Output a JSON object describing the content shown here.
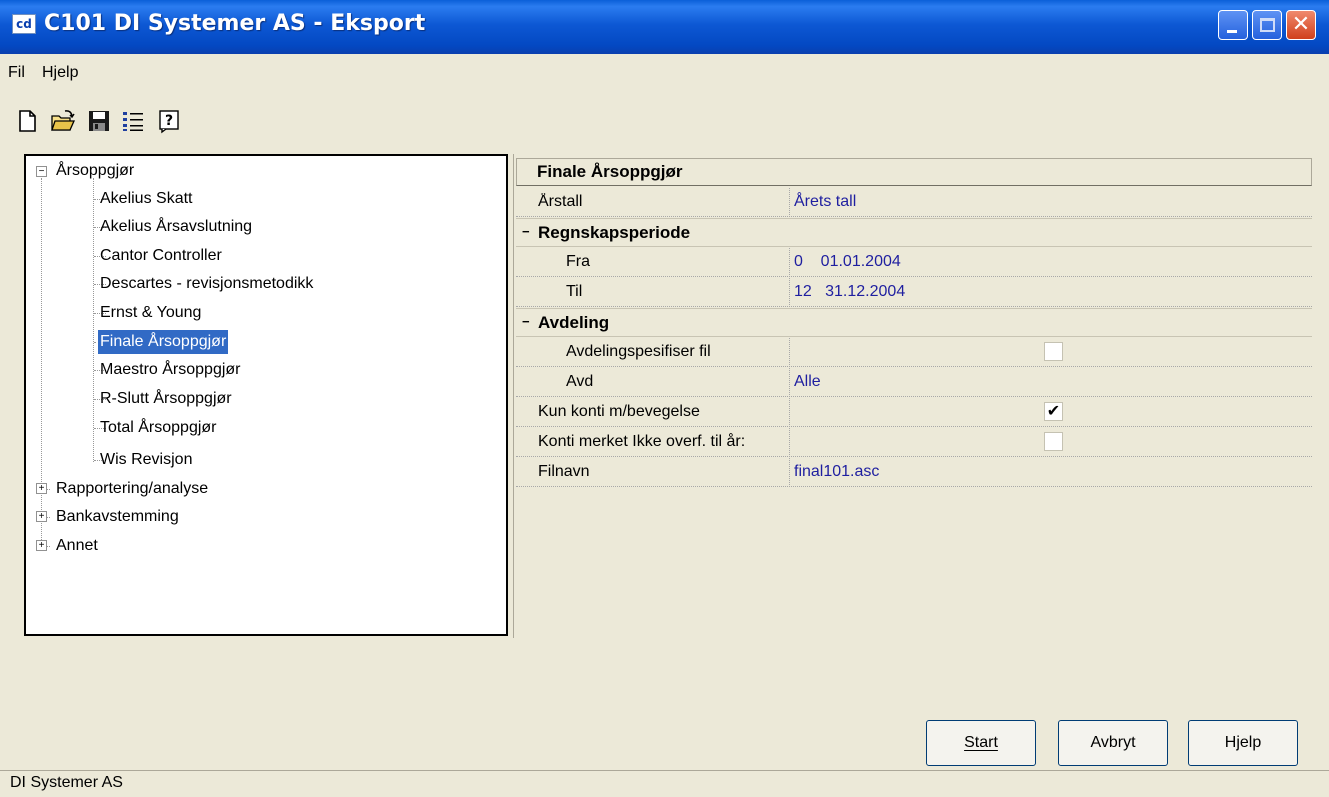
{
  "window": {
    "title": "C101 DI Systemer AS - Eksport",
    "icon_text": "cd"
  },
  "menu": {
    "items": [
      "Fil",
      "Hjelp"
    ]
  },
  "toolbar": {
    "icons": [
      "new-document-icon",
      "open-folder-icon",
      "save-disk-icon",
      "list-icon",
      "help-icon"
    ]
  },
  "tree": {
    "root": "Årsoppgjør",
    "children": [
      "Akelius Skatt",
      "Akelius Årsavslutning",
      "Cantor Controller",
      "Descartes - revisjonsmetodikk",
      "Ernst & Young",
      "Finale Årsoppgjør",
      "Maestro Årsoppgjør",
      "R-Slutt Årsoppgjør",
      "Total Årsoppgjør",
      "Wis Revisjon"
    ],
    "selected": "Finale Årsoppgjør",
    "collapsed": [
      "Rapportering/analyse",
      "Bankavstemming",
      "Annet"
    ]
  },
  "grid": {
    "header": "Finale Årsoppgjør",
    "arstall": {
      "label": "Årstall",
      "value": "Årets tall"
    },
    "regnskapsperiode": {
      "label": "Regnskapsperiode",
      "fra": {
        "label": "Fra",
        "value": "0    01.01.2004"
      },
      "til": {
        "label": "Til",
        "value": "12   31.12.2004"
      }
    },
    "avdeling": {
      "label": "Avdeling",
      "spesifiser": {
        "label": "Avdelingspesifiser fil",
        "checked": false
      },
      "avd": {
        "label": "Avd",
        "value": "Alle"
      }
    },
    "kun_konti": {
      "label": "Kun konti m/bevegelse",
      "checked": true
    },
    "konti_merket": {
      "label": "Konti merket Ikke overf. til år:",
      "checked": false
    },
    "filnavn": {
      "label": "Filnavn",
      "value": "final101.asc"
    }
  },
  "buttons": {
    "start": "Start",
    "avbryt": "Avbryt",
    "hjelp": "Hjelp"
  },
  "status": "DI Systemer AS",
  "colors": {
    "titlebar": "#0a5fd8",
    "selection": "#316ac5",
    "value_text": "#1f1fa0",
    "window_bg": "#ece9d8"
  }
}
